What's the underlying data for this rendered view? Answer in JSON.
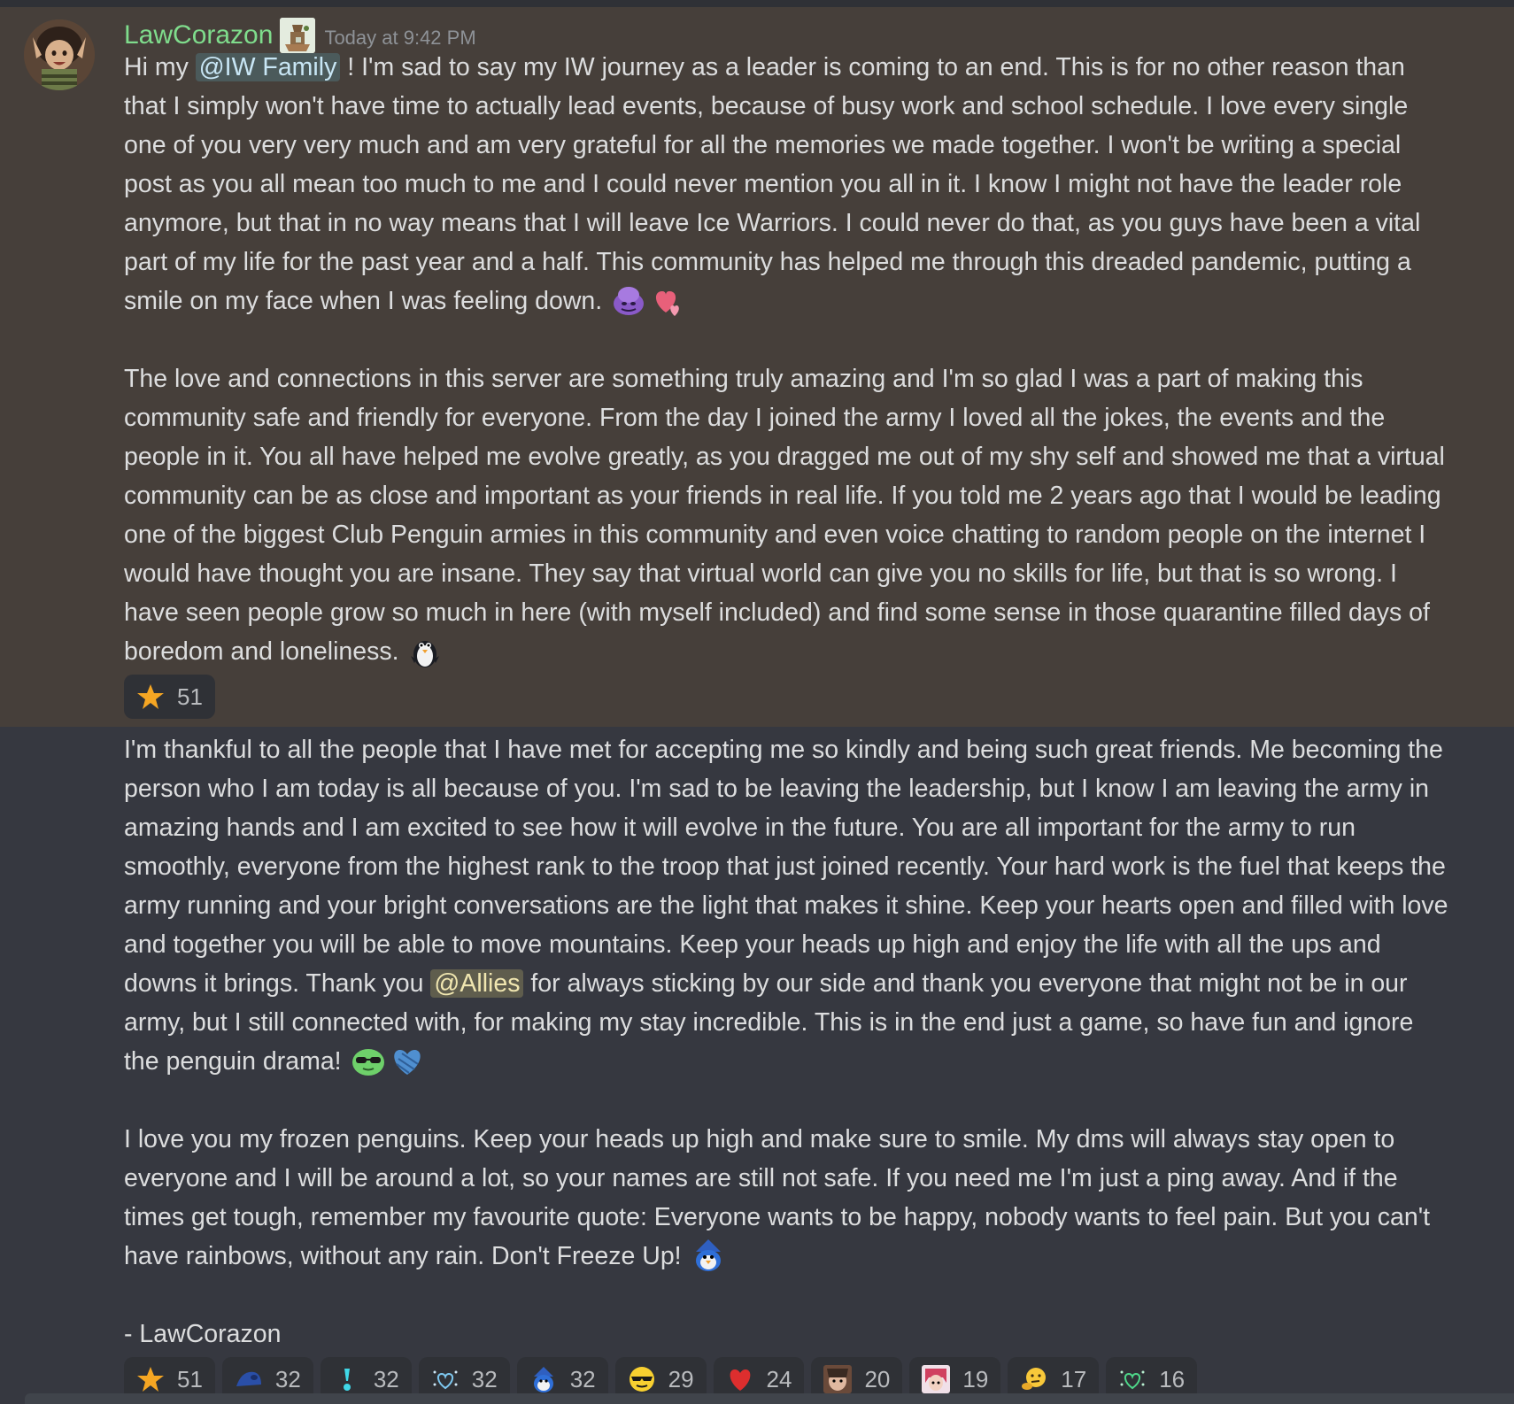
{
  "message": {
    "username": "LawCorazon",
    "timestamp": "Today at 9:42 PM",
    "para1": {
      "before_mention": "Hi my ",
      "mention": "@IW Family",
      "after_mention": " ! I'm sad to say my IW journey as a leader is coming to an end. This is for no other reason than that I simply won't have time to actually lead events, because of busy work and school schedule. I love every single one of you very very much and am very grateful for all the memories we made together. I won't be writing a special post as you all mean too much to me and I could never mention you all in it. I know I might not have the leader role anymore, but that in no way means that I will leave Ice Warriors. I could never do that, as you guys have been a vital part of my life for the past year and a half. This community has helped me through this dreaded pandemic, putting a smile on my face when I was feeling down. "
    },
    "para2": "The love and connections in this server are something truly amazing and I'm so glad I was a part of making this community safe and friendly for everyone. From the day I joined the army I loved all the jokes, the events and the people in it. You all have helped me evolve greatly, as you dragged me out of my shy self and showed me that a virtual community can be as close and important as your friends in real life. If you told me 2 years ago that I would be leading one of the biggest Club Penguin armies in this community and even voice chatting to random people on the internet I would have thought you are insane. They say that virtual world can give you no skills for life, but that is so wrong. I have seen people grow so much in here (with myself included) and find some sense in those quarantine filled days of boredom and loneliness. ",
    "first_reactions": [
      {
        "icon": "star-icon",
        "count": "51"
      }
    ],
    "para3": {
      "before_mention": "I'm thankful to all the people that I have met for accepting me so kindly and being such great friends. Me becoming the person who I am today is all because of you. I'm sad to be leaving the leadership, but I know I am leaving the army in amazing hands and I am excited to see how it will evolve in the future. You are all important for the army to run smoothly, everyone from the highest rank to the troop that just joined recently. Your hard work is the fuel that keeps the army running and your bright conversations are the light that makes it shine. Keep your hearts open and filled with love and together you will be able to move mountains. Keep your heads up high and enjoy the life with all the ups and downs it brings. Thank you ",
      "mention": "@Allies",
      "after_mention": " for always sticking by our side and thank you everyone that might not be in our army, but I still connected with, for making my stay incredible. This is in the end just a game, so have fun and ignore the penguin drama! "
    },
    "para4": "I love you my frozen penguins. Keep your heads up high and make sure to smile. My dms will always stay open to everyone and I will be around a lot, so your names are still not safe. If you need me I'm just a ping away. And if the times get tough, remember my favourite quote: Everyone wants to be happy, nobody wants to feel pain. But you can't have rainbows, without any rain. Don't Freeze Up! ",
    "signature": "- LawCorazon",
    "second_reactions": [
      {
        "icon": "star-icon",
        "count": "51"
      },
      {
        "icon": "blue-penguin-icon",
        "count": "32"
      },
      {
        "icon": "cyan-exclamation-icon",
        "count": "32"
      },
      {
        "icon": "sparkle-heart-icon",
        "count": "32"
      },
      {
        "icon": "penguin-mage-icon",
        "count": "32"
      },
      {
        "icon": "yellow-sunglasses-icon",
        "count": "29"
      },
      {
        "icon": "red-heart-icon",
        "count": "24"
      },
      {
        "icon": "anime-face-icon",
        "count": "20"
      },
      {
        "icon": "pink-hair-avatar-icon",
        "count": "19"
      },
      {
        "icon": "thinking-face-icon",
        "count": "17"
      },
      {
        "icon": "green-sparkle-heart-icon",
        "count": "16"
      }
    ]
  },
  "colors": {
    "username": "#7fdc8c",
    "background_highlight": "#463f3a",
    "background": "#363840"
  }
}
